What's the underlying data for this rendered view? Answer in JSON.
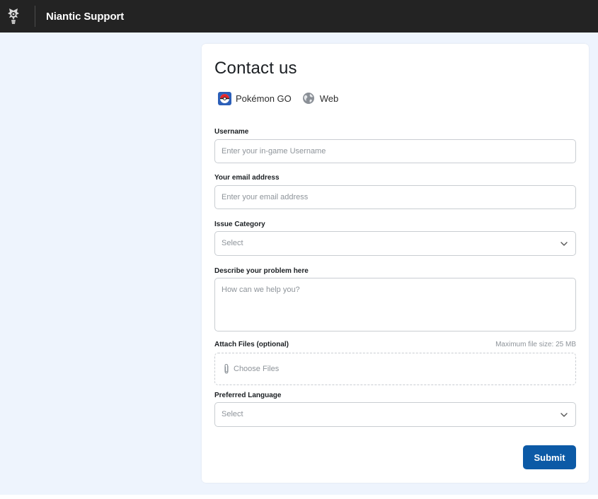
{
  "header": {
    "brand": "Niantic Support",
    "logo_icon": "niantic-logo-icon"
  },
  "form": {
    "title": "Contact us",
    "tags": [
      {
        "label": "Pokémon GO",
        "icon": "pokeball-icon"
      },
      {
        "label": "Web",
        "icon": "globe-icon"
      }
    ],
    "username": {
      "label": "Username",
      "placeholder": "Enter your in-game Username"
    },
    "email": {
      "label": "Your email address",
      "placeholder": "Enter your email address"
    },
    "issue_category": {
      "label": "Issue Category",
      "value": "Select"
    },
    "description": {
      "label": "Describe your problem here",
      "placeholder": "How can we help you?"
    },
    "attachments": {
      "label": "Attach Files (optional)",
      "max_size": "Maximum file size: 25 MB",
      "button": "Choose Files"
    },
    "language": {
      "label": "Preferred Language",
      "value": "Select"
    },
    "submit_label": "Submit"
  },
  "colors": {
    "topbar": "#232323",
    "page_background": "#eef4fd",
    "accent": "#0c5aa6",
    "border": "#c9cdd2",
    "placeholder": "#8e949a"
  }
}
